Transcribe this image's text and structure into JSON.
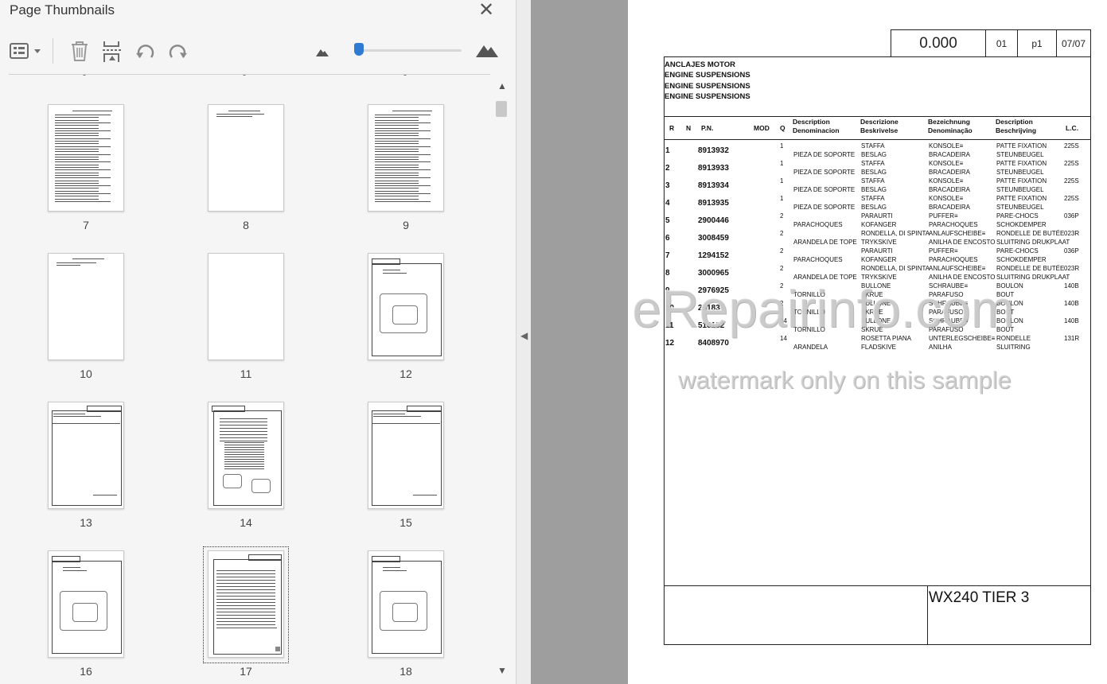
{
  "panel": {
    "title": "Page Thumbnails",
    "close_icon": "close-icon",
    "toolbar": {
      "options_icon": "options-menu-icon",
      "delete_icon": "trash-icon",
      "extract_icon": "extract-pages-icon",
      "rotate_ccw_icon": "rotate-counterclockwise-icon",
      "rotate_cw_icon": "rotate-clockwise-icon",
      "zoom_out_icon": "small-mountain-icon",
      "zoom_in_icon": "large-mountain-icon",
      "zoom_level": 0.04
    },
    "thumbnails": [
      {
        "page": "7"
      },
      {
        "page": "8"
      },
      {
        "page": "9"
      },
      {
        "page": "10"
      },
      {
        "page": "11"
      },
      {
        "page": "12"
      },
      {
        "page": "13"
      },
      {
        "page": "14"
      },
      {
        "page": "15"
      },
      {
        "page": "16"
      },
      {
        "page": "17",
        "selected": true
      },
      {
        "page": "18"
      }
    ]
  },
  "document": {
    "header": {
      "value": "0.000",
      "section": "01",
      "page": "p1",
      "date": "07/07"
    },
    "titles": [
      "ANCLAJES MOTOR",
      "ENGINE SUSPENSIONS",
      "ENGINE SUSPENSIONS",
      "ENGINE SUSPENSIONS"
    ],
    "columns": {
      "r": "R",
      "n": "N",
      "pn": "P.N.",
      "mod": "MOD",
      "q": "Q",
      "desc1": [
        "Description",
        "Denominacion"
      ],
      "desc2": [
        "Descrizione",
        "Beskrivelse"
      ],
      "desc3": [
        "Bezeichnung",
        "Denominação"
      ],
      "desc4": [
        "Description",
        "Beschrijving"
      ],
      "lc": "L.C."
    },
    "rows": [
      {
        "r": "1",
        "pn": "8913932",
        "q": "1",
        "d_es": "PIEZA DE SOPORTE",
        "it": "STAFFA",
        "da": "BESLAG",
        "de": "KONSOLE≡",
        "pt": "BRACADEIRA",
        "fr": "PATTE FIXATION",
        "nl": "STEUNBEUGEL",
        "lc": "225S"
      },
      {
        "r": "2",
        "pn": "8913933",
        "q": "1",
        "d_es": "PIEZA DE SOPORTE",
        "it": "STAFFA",
        "da": "BESLAG",
        "de": "KONSOLE≡",
        "pt": "BRACADEIRA",
        "fr": "PATTE FIXATION",
        "nl": "STEUNBEUGEL",
        "lc": "225S"
      },
      {
        "r": "3",
        "pn": "8913934",
        "q": "1",
        "d_es": "PIEZA DE SOPORTE",
        "it": "STAFFA",
        "da": "BESLAG",
        "de": "KONSOLE≡",
        "pt": "BRACADEIRA",
        "fr": "PATTE FIXATION",
        "nl": "STEUNBEUGEL",
        "lc": "225S"
      },
      {
        "r": "4",
        "pn": "8913935",
        "q": "1",
        "d_es": "PIEZA DE SOPORTE",
        "it": "STAFFA",
        "da": "BESLAG",
        "de": "KONSOLE≡",
        "pt": "BRACADEIRA",
        "fr": "PATTE FIXATION",
        "nl": "STEUNBEUGEL",
        "lc": "225S"
      },
      {
        "r": "5",
        "pn": "2900446",
        "q": "2",
        "d_es": "PARACHOQUES",
        "it": "PARAURTI",
        "da": "KOFANGER",
        "de": "PUFFER≡",
        "pt": "PARACHOQUES",
        "fr": "PARE-CHOCS",
        "nl": "SCHOKDEMPER",
        "lc": "036P"
      },
      {
        "r": "6",
        "pn": "3008459",
        "q": "2",
        "d_es": "ARANDELA DE TOPE",
        "it": "RONDELLA, DI SPINTA",
        "da": "TRYKSKIVE",
        "de": "ANLAUFSCHEIBE≡",
        "pt": "ANILHA DE ENCOSTO",
        "fr": "RONDELLE DE BUTÉE",
        "nl": "SLUITRING DRUKPLAAT",
        "lc": "023R"
      },
      {
        "r": "7",
        "pn": "1294152",
        "q": "2",
        "d_es": "PARACHOQUES",
        "it": "PARAURTI",
        "da": "KOFANGER",
        "de": "PUFFER≡",
        "pt": "PARACHOQUES",
        "fr": "PARE-CHOCS",
        "nl": "SCHOKDEMPER",
        "lc": "036P"
      },
      {
        "r": "8",
        "pn": "3000965",
        "q": "2",
        "d_es": "ARANDELA DE TOPE",
        "it": "RONDELLA, DI SPINTA",
        "da": "TRYKSKIVE",
        "de": "ANLAUFSCHEIBE≡",
        "pt": "ANILHA DE ENCOSTO",
        "fr": "RONDELLE DE BUTÉE",
        "nl": "SLUITRING DRUKPLAAT",
        "lc": "023R"
      },
      {
        "r": "9",
        "pn": "2976925",
        "q": "2",
        "d_es": "TORNILLO",
        "it": "BULLONE",
        "da": "SKRUE",
        "de": "SCHRAUBE≡",
        "pt": "PARAFUSO",
        "fr": "BOULON",
        "nl": "BOUT",
        "lc": "140B"
      },
      {
        "r": "10",
        "pn": "251836",
        "q": "2",
        "d_es": "TORNILLO",
        "it": "BULLONE",
        "da": "SKRUE",
        "de": "SCHRAUBE≡",
        "pt": "PARAFUSO",
        "fr": "BOULON",
        "nl": "BOUT",
        "lc": "140B"
      },
      {
        "r": "11",
        "pn": "518152",
        "q": "14",
        "d_es": "TORNILLO",
        "it": "BULLONE",
        "da": "SKRUE",
        "de": "SCHRAUBE≡",
        "pt": "PARAFUSO",
        "fr": "BOULON",
        "nl": "BOUT",
        "lc": "140B"
      },
      {
        "r": "12",
        "pn": "8408970",
        "q": "14",
        "d_es": "ARANDELA",
        "it": "ROSETTA PIANA",
        "da": "FLADSKIVE",
        "de": "UNTERLEGSCHEIBE≡",
        "pt": "ANILHA",
        "fr": "RONDELLE",
        "nl": "SLUITRING",
        "lc": "131R"
      }
    ],
    "model": "WX240 TIER 3",
    "watermark_main": "eRepairinfo.com",
    "watermark_sub": "watermark only on this sample"
  }
}
